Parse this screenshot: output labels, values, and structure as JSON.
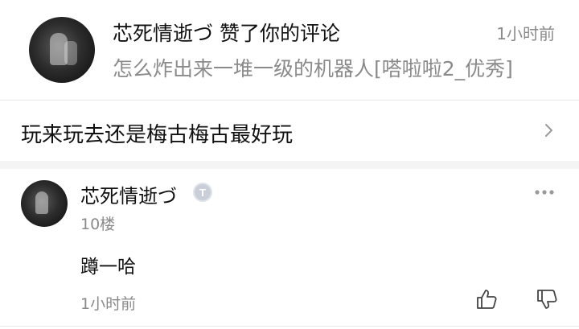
{
  "notification": {
    "avatar": "user-avatar-image",
    "title": "芯死情逝づ 赞了你的评论",
    "time": "1小时前",
    "subtitle": "怎么炸出来一堆一级的机器人[嗒啦啦2_优秀]"
  },
  "post": {
    "text": "玩来玩去还是梅古梅古最好玩",
    "icon": "chevron-right-icon"
  },
  "comment": {
    "avatar": "user-avatar-image",
    "name": "芯死情逝づ",
    "badge_text": "T",
    "floor": "10楼",
    "body": "蹲一哈",
    "time": "1小时前",
    "icons": [
      "more-icon",
      "thumb-up-icon",
      "thumb-down-icon"
    ]
  },
  "colors": {
    "primary_text": "#111111",
    "secondary_text": "#8a8a8a",
    "divider": "#e8e8e8",
    "section_gap": "#f4f4f4",
    "badge": "#c9ced8"
  }
}
